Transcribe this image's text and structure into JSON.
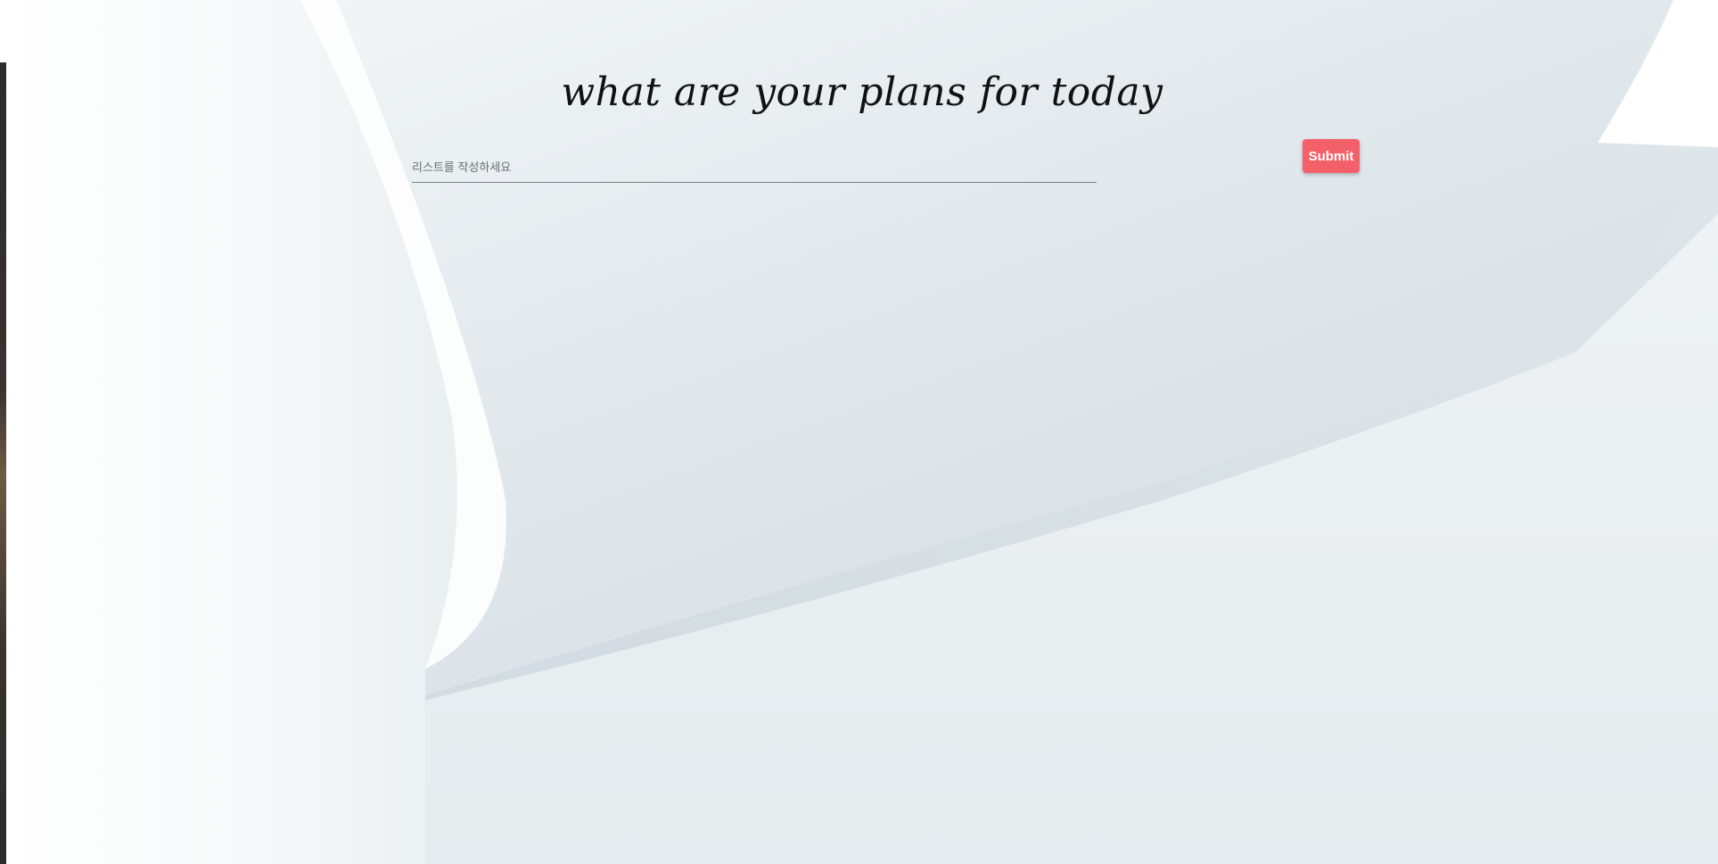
{
  "header": {
    "title": "what are your plans for today"
  },
  "todo_form": {
    "input_placeholder": "리스트를 작성하세요",
    "input_value": "",
    "submit_label": "Submit"
  },
  "colors": {
    "accent": "#f4606a",
    "background": "#e4eaee"
  }
}
